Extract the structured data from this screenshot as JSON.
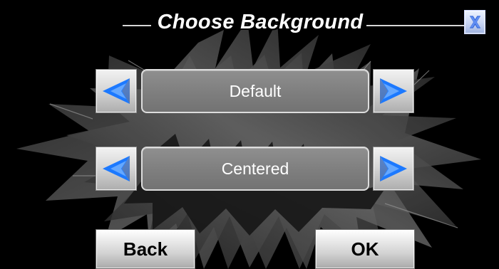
{
  "header": {
    "title": "Choose Background"
  },
  "controls": {
    "close_label": "X",
    "row1": {
      "value": "Default"
    },
    "row2": {
      "value": "Centered"
    }
  },
  "footer": {
    "back_label": "Back",
    "ok_label": "OK"
  },
  "icons": {
    "close": "close-icon",
    "left": "chevron-left-icon",
    "right": "chevron-right-icon"
  },
  "colors": {
    "screen_background": "#000000",
    "arrow_blue": "#1c79ff",
    "value_box": "#7e7e7e",
    "value_border": "#dddddd",
    "button_face": "#d3d3d3",
    "close_blue": "#2d63d9"
  }
}
